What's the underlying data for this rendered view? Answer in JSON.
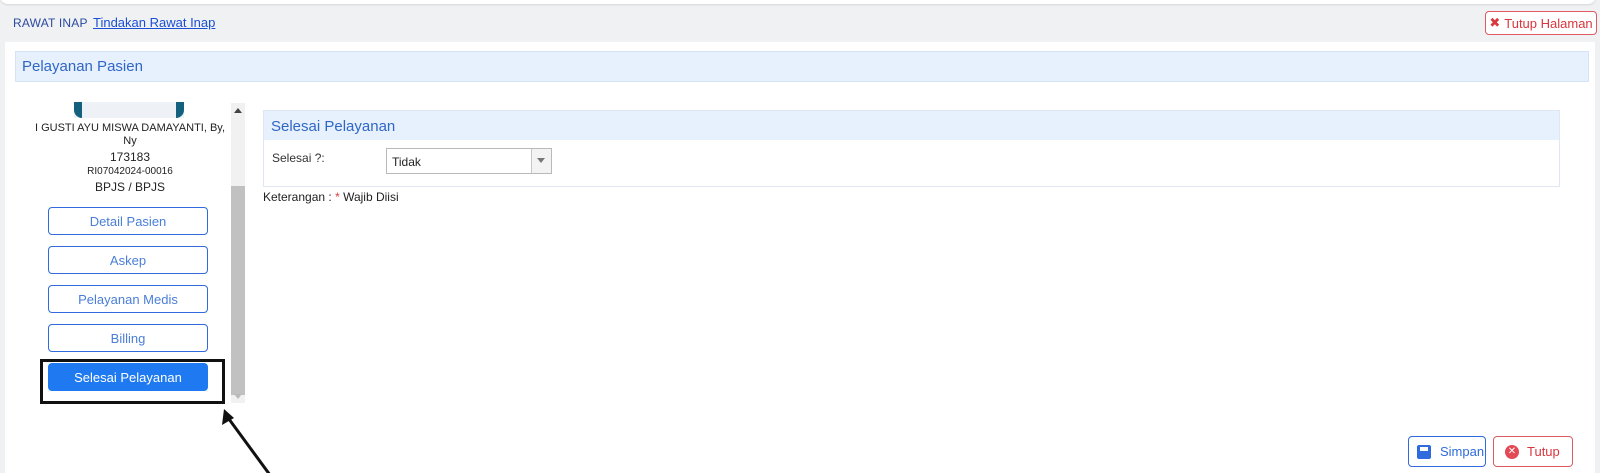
{
  "breadcrumb": {
    "section": "RAWAT INAP",
    "page": "Tindakan Rawat Inap"
  },
  "close_page": {
    "icon": "close-icon",
    "label": "Tutup Halaman"
  },
  "panel": {
    "title": "Pelayanan Pasien"
  },
  "patient": {
    "name": "I GUSTI AYU MISWA DAMAYANTI, By, Ny",
    "rm": "173183",
    "reg_no": "RI07042024-00016",
    "payer": "BPJS / BPJS"
  },
  "nav": {
    "items": [
      "Detail Pasien",
      "Askep",
      "Pelayanan Medis",
      "Billing",
      "Selesai Pelayanan"
    ],
    "active_index": 4
  },
  "section": {
    "title": "Selesai Pelayanan",
    "field_label": "Selesai ?:",
    "select_value": "Tidak"
  },
  "note": {
    "prefix": "Keterangan : ",
    "star": "*",
    "text": " Wajib Diisi"
  },
  "footer": {
    "save_label": "Simpan",
    "cancel_label": "Tutup"
  },
  "colors": {
    "accent": "#1f7af1",
    "danger": "#d9363e",
    "header_bg": "#e7f0fd"
  }
}
